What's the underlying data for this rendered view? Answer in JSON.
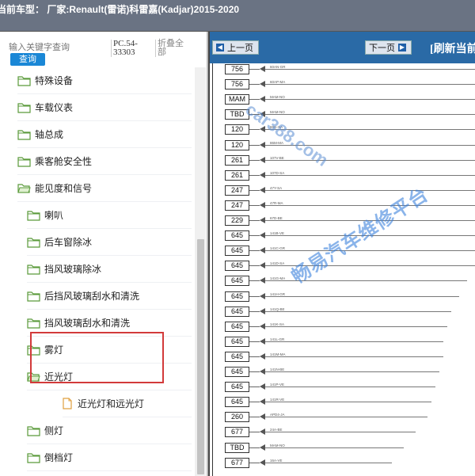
{
  "header": {
    "title": "当前车型： 厂家:Renault(雷诺)科雷嘉(Kadjar)2015-2020"
  },
  "search": {
    "placeholder": "输入关键字查询",
    "button_label": "查询",
    "pc_code": "PC.54-33303",
    "collapse_all_label": "折叠全部"
  },
  "tree": [
    {
      "label": "特殊设备",
      "level": 1,
      "icon": "folder-icon"
    },
    {
      "label": "车载仪表",
      "level": 1,
      "icon": "folder-icon"
    },
    {
      "label": "轴总成",
      "level": 1,
      "icon": "folder-icon"
    },
    {
      "label": "乘客舱安全性",
      "level": 1,
      "icon": "folder-icon"
    },
    {
      "label": "能见度和信号",
      "level": 1,
      "icon": "folder-open-icon"
    },
    {
      "label": "喇叭",
      "level": 2,
      "icon": "folder-icon"
    },
    {
      "label": "后车窗除冰",
      "level": 2,
      "icon": "folder-icon"
    },
    {
      "label": "挡风玻璃除冰",
      "level": 2,
      "icon": "folder-icon"
    },
    {
      "label": "后挡风玻璃刮水和清洗",
      "level": 2,
      "icon": "folder-icon"
    },
    {
      "label": "挡风玻璃刮水和清洗",
      "level": 2,
      "icon": "folder-icon"
    },
    {
      "label": "雾灯",
      "level": 2,
      "icon": "folder-icon"
    },
    {
      "label": "近光灯",
      "level": 2,
      "icon": "folder-open-icon"
    },
    {
      "label": "近光灯和远光灯",
      "level": 3,
      "icon": "file-icon"
    },
    {
      "label": "侧灯",
      "level": 2,
      "icon": "folder-icon"
    },
    {
      "label": "倒档灯",
      "level": 2,
      "icon": "folder-icon"
    }
  ],
  "toolbar": {
    "prev_label": "上一页",
    "next_label": "下一页",
    "refresh_label": "[刷新当前"
  },
  "diagram": {
    "wires": [
      {
        "box": "756",
        "code": "60AN-GR"
      },
      {
        "box": "756",
        "code": "60AP-MA"
      },
      {
        "box": "MAM",
        "code": "MAM-NO"
      },
      {
        "box": "TBD",
        "code": "MAM-NO"
      },
      {
        "box": "120",
        "code": "86G-SA"
      },
      {
        "box": "120",
        "code": "86M-MA"
      },
      {
        "box": "261",
        "code": "107V-BE"
      },
      {
        "box": "261",
        "code": "107D-SA"
      },
      {
        "box": "247",
        "code": "47Y-SA"
      },
      {
        "box": "247",
        "code": "47R-MA"
      },
      {
        "box": "229",
        "code": "67D-BE"
      },
      {
        "box": "645",
        "code": "141B-VE"
      },
      {
        "box": "645",
        "code": "141C-GR"
      },
      {
        "box": "645",
        "code": "141D-SA"
      },
      {
        "box": "645",
        "code": "141G-MA"
      },
      {
        "box": "645",
        "code": "141H-GR"
      },
      {
        "box": "645",
        "code": "141Q-BE"
      },
      {
        "box": "645",
        "code": "141K-SA"
      },
      {
        "box": "645",
        "code": "141L-GR"
      },
      {
        "box": "645",
        "code": "141M-MA"
      },
      {
        "box": "645",
        "code": "141N-BE"
      },
      {
        "box": "645",
        "code": "141P-VE"
      },
      {
        "box": "645",
        "code": "141R-VE"
      },
      {
        "box": "260",
        "code": "APD4-JA"
      },
      {
        "box": "677",
        "code": "24A-BE"
      },
      {
        "box": "TBD",
        "code": "MAM-NO"
      },
      {
        "box": "677",
        "code": "16A-VE"
      }
    ]
  },
  "watermark": {
    "url": "car388.com",
    "text": "畅易汽车维修平台"
  },
  "colors": {
    "toolbar": "#2a6aa6",
    "header": "#6a7383",
    "highlight": "#d23a3a",
    "search_button": "#1a87d6"
  }
}
